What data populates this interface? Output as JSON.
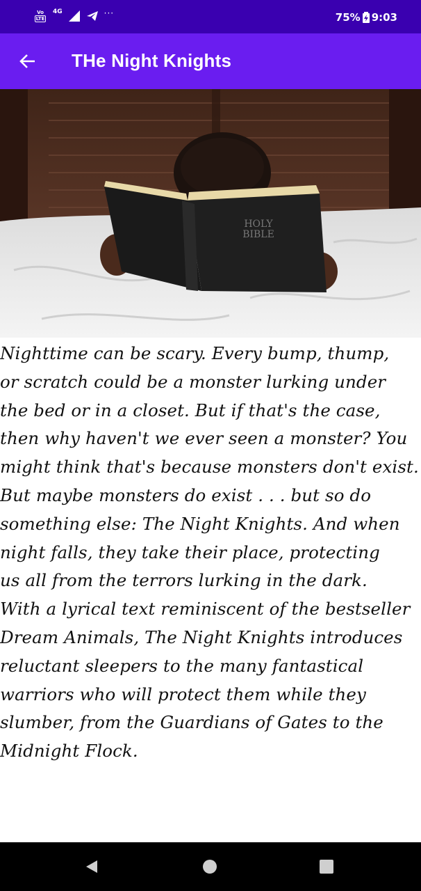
{
  "status_bar": {
    "volte_top": "Vo",
    "volte_bottom": "LTE",
    "network": "4G",
    "more": "···",
    "battery": "75%",
    "time": "9:03"
  },
  "app_bar": {
    "title": "THe Night Knights",
    "back_icon": "arrow-left-icon"
  },
  "hero": {
    "book_line1": "HOLY",
    "book_line2": "BIBLE"
  },
  "story": {
    "text": "Nighttime can be scary. Every bump, thump,\nor scratch could be a monster lurking under\nthe bed or in a closet. But if that's the case,\nthen why haven't we ever seen a monster? You\nmight think that's because monsters don't exist.\nBut maybe monsters do exist . . . but so do\nsomething else: The Night Knights. And when\nnight falls, they take their place, protecting\nus all from the terrors lurking in the dark.\nWith a lyrical text reminiscent of the bestseller\nDream Animals, The Night Knights introduces\nreluctant sleepers to the many fantastical\nwarriors who will protect them while they\nslumber, from the Guardians of Gates to the\nMidnight Flock."
  },
  "nav_bar": {
    "back_icon": "triangle-back-icon",
    "home_icon": "circle-home-icon",
    "recent_icon": "square-recents-icon"
  },
  "colors": {
    "status_bar": "#3a00b0",
    "app_bar": "#6a1df0",
    "nav_bar": "#000000"
  }
}
